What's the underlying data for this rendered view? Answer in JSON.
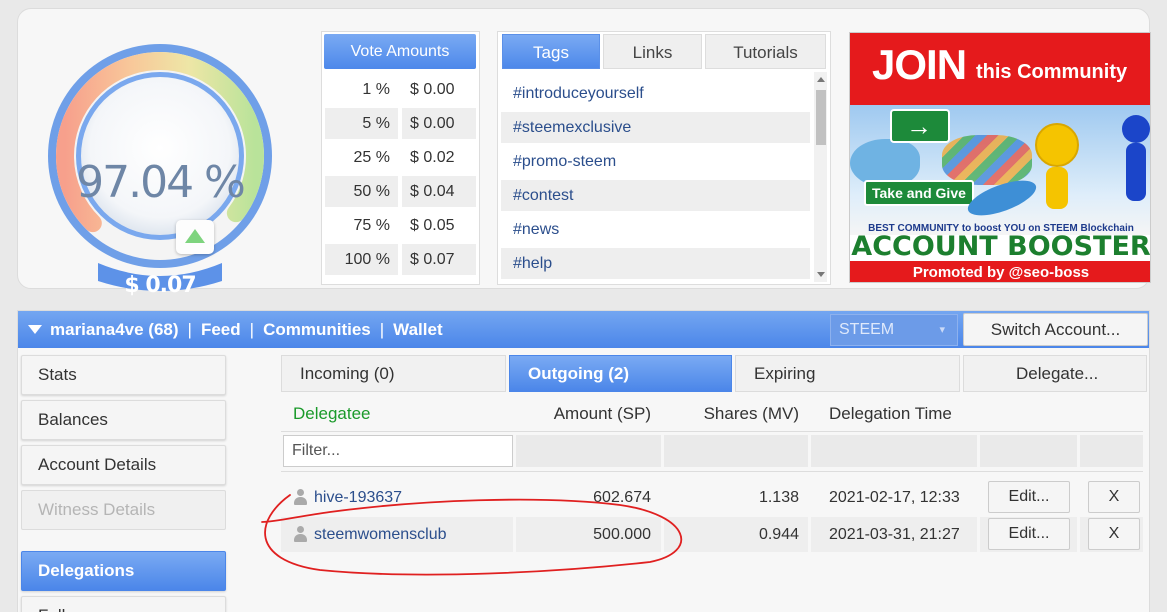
{
  "gauge": {
    "percent": "97.04 %",
    "value": "$ 0.07",
    "fill": 0.9704
  },
  "vote_amounts": {
    "title": "Vote Amounts",
    "rows": [
      {
        "pct": "1 %",
        "val": "$ 0.00"
      },
      {
        "pct": "5 %",
        "val": "$ 0.00"
      },
      {
        "pct": "25 %",
        "val": "$ 0.02"
      },
      {
        "pct": "50 %",
        "val": "$ 0.04"
      },
      {
        "pct": "75 %",
        "val": "$ 0.05"
      },
      {
        "pct": "100 %",
        "val": "$ 0.07"
      }
    ]
  },
  "info_tabs": [
    "Tags",
    "Links",
    "Tutorials"
  ],
  "tags": [
    "#introduceyourself",
    "#steemexclusive",
    "#promo-steem",
    "#contest",
    "#news",
    "#help"
  ],
  "banner": {
    "join": "JOIN",
    "this_community": "this Community",
    "take_and_give": "Take and Give",
    "best": "BEST COMMUNITY to boost YOU on STEEM Blockchain",
    "account_booster": "ACCOUNT BOOSTER",
    "promoted_by": "Promoted by @seo-boss"
  },
  "account_bar": {
    "account": "mariana4ve (68)",
    "sep": "|",
    "links": [
      "Feed",
      "Communities",
      "Wallet"
    ],
    "chain_select": "STEEM",
    "switch_account": "Switch Account..."
  },
  "sidebar": [
    "Stats",
    "Balances",
    "Account Details",
    "Witness Details",
    "Delegations",
    "Followers"
  ],
  "delegation_tabs": [
    "Incoming (0)",
    "Outgoing (2)",
    "Expiring",
    "Delegate..."
  ],
  "delegation_table": {
    "headers": [
      "Delegatee",
      "Amount (SP)",
      "Shares (MV)",
      "Delegation Time"
    ],
    "filter_placeholder": "Filter...",
    "edit_label": "Edit...",
    "remove_label": "X",
    "rows": [
      {
        "delegatee": "hive-193637",
        "amount": "602.674",
        "shares": "1.138",
        "time": "2021-02-17, 12:33"
      },
      {
        "delegatee": "steemwomensclub",
        "amount": "500.000",
        "shares": "0.944",
        "time": "2021-03-31, 21:27"
      }
    ]
  },
  "colors": {
    "accent": "#4d88ea",
    "link": "#2b4e8c",
    "header_green": "#1a9a2a",
    "annotation_red": "#e02020"
  }
}
